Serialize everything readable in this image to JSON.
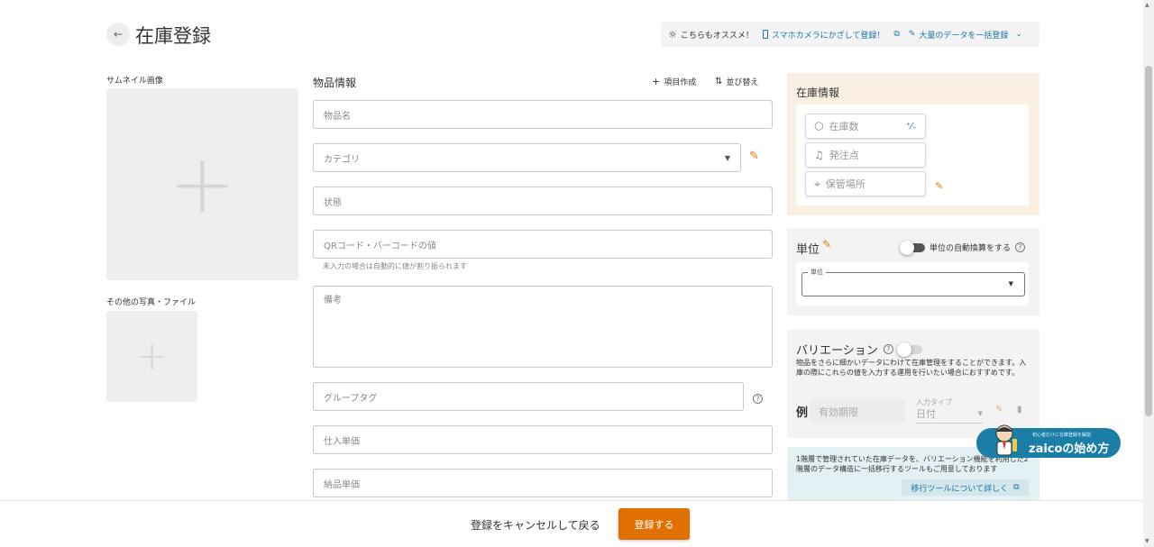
{
  "header": {
    "title": "在庫登録",
    "back_icon": "arrow-left-icon",
    "recommend_label": "こちらもオススメ！",
    "camera_link": "スマホカメラにかざして登録！",
    "bulk_link": "大量のデータを一括登録"
  },
  "thumbnail": {
    "label": "サムネイル画像",
    "other_label": "その他の写真・ファイル"
  },
  "item_info": {
    "title": "物品情報",
    "create_field": "項目作成",
    "sort": "並び替え",
    "name_placeholder": "物品名",
    "category_placeholder": "カテゴリ",
    "state_placeholder": "状態",
    "code_placeholder": "QRコード・バーコードの値",
    "code_hint": "未入力の場合は自動的に値が割り振られます",
    "remarks_placeholder": "備考",
    "group_tag_placeholder": "グループタグ",
    "purchase_price_placeholder": "仕入単価",
    "delivery_price_placeholder": "納品単価"
  },
  "stock_info": {
    "title": "在庫情報",
    "quantity": "在庫数",
    "quantity_suffix": "⁺⁄₋",
    "order_point": "発注点",
    "location": "保管場所"
  },
  "unit": {
    "title": "単位",
    "auto_convert": "単位の自動換算をする",
    "field_label": "単位"
  },
  "variation": {
    "title": "バリエーション",
    "description": "物品をさらに細かいデータにわけて在庫管理をすることができます。入庫の際にこれらの値を入力する運用を行いたい場合におすすめです。",
    "example_label": "例",
    "example_value": "有効期限",
    "input_type_label": "入力タイプ",
    "input_type_value": "日付"
  },
  "migration": {
    "text": "1階層で管理されていた在庫データを、バリエーション機能を利用した2階層のデータ構造に一括移行するツールもご用意しております",
    "link": "移行ツールについて詳しく"
  },
  "promo": {
    "small": "初心者むけに在庫登録を解説",
    "main": "zaicoの始め方"
  },
  "footer": {
    "cancel": "登録をキャンセルして戻る",
    "submit": "登録する"
  },
  "colors": {
    "accent": "#e07000",
    "link": "#1a73a8",
    "stock_panel": "#fbeee3",
    "migration_panel": "#e3f1f4"
  }
}
